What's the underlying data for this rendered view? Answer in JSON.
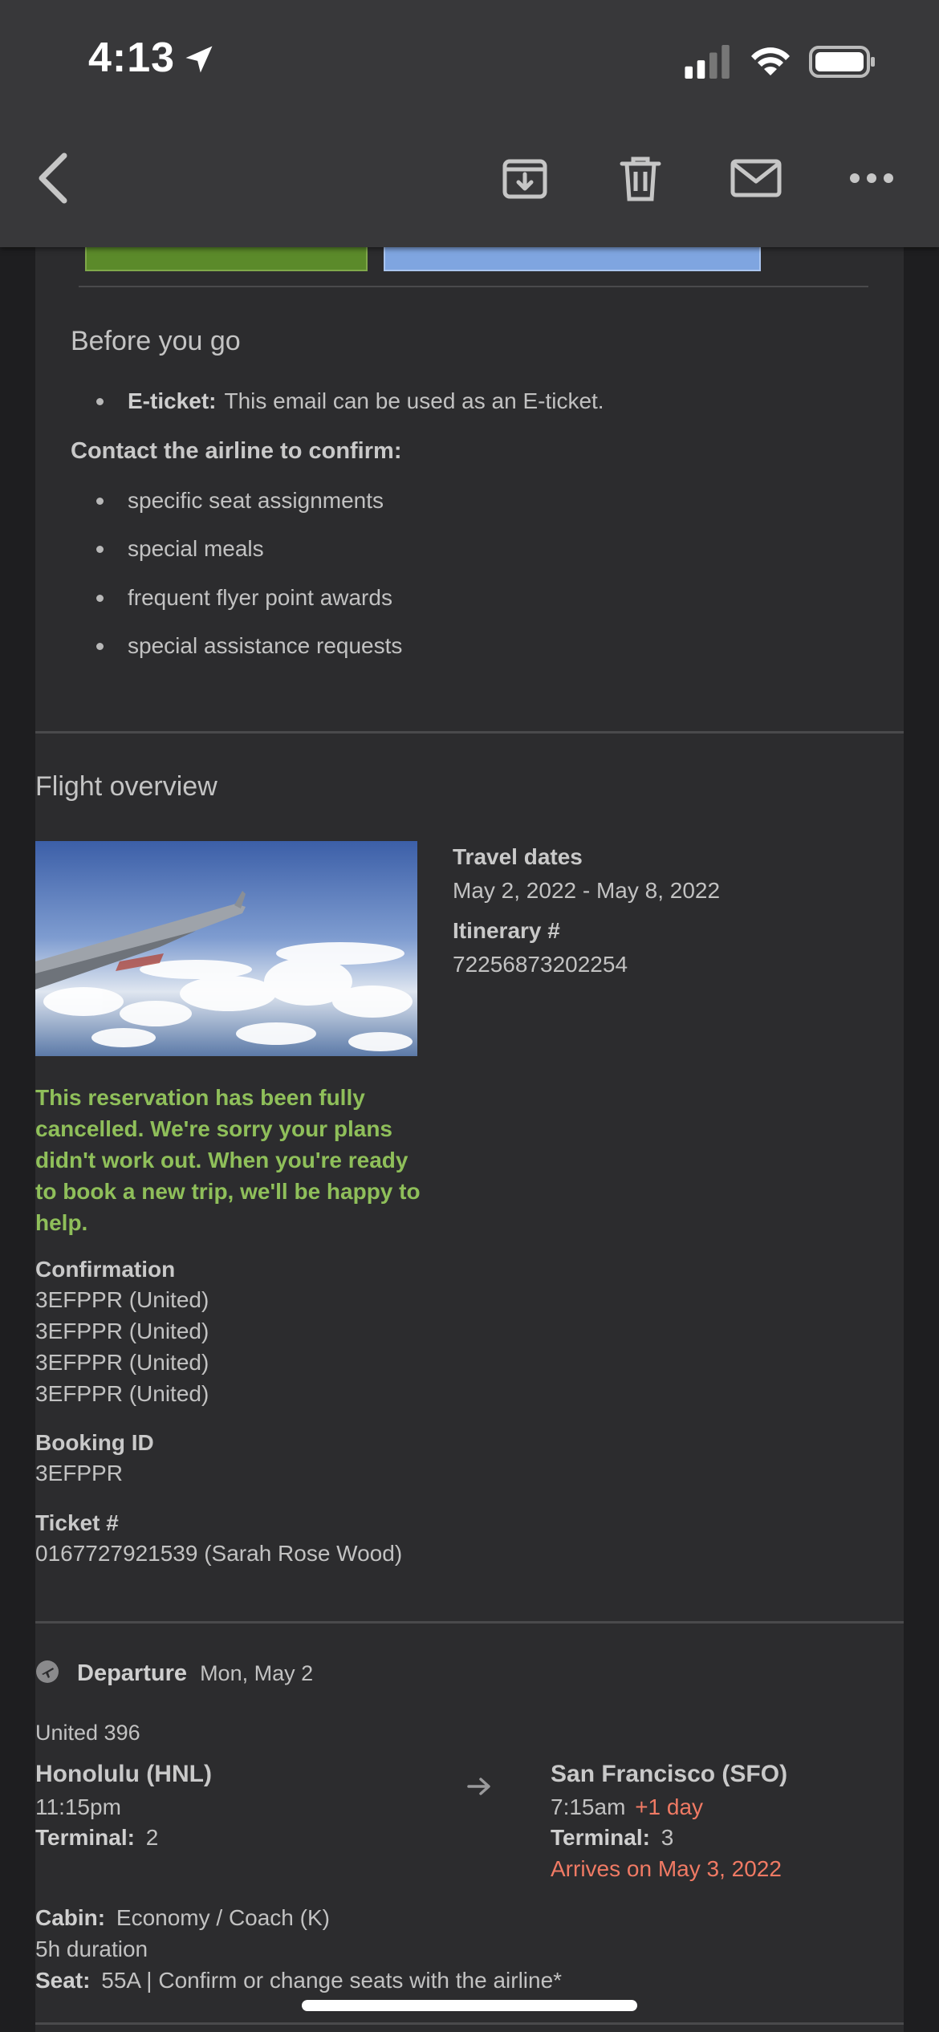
{
  "status_bar": {
    "time": "4:13"
  },
  "top_bar": {
    "back_icon": "chevron-left-icon",
    "archive_icon": "archive-icon",
    "delete_icon": "trash-icon",
    "mail_icon": "mail-icon",
    "more_icon": "more-icon"
  },
  "before_you_go": {
    "title": "Before you go",
    "eticket_label": "E-ticket:",
    "eticket_text": "This email can be used as an E-ticket.",
    "contact_title": "Contact the airline to confirm:",
    "items": [
      "specific seat assignments",
      "special meals",
      "frequent flyer point awards",
      "special assistance requests"
    ]
  },
  "overview": {
    "title": "Flight overview",
    "travel_dates_label": "Travel dates",
    "travel_dates": "May 2, 2022 - May 8, 2022",
    "itinerary_label": "Itinerary #",
    "itinerary": "72256873202254",
    "cancel_message": "This reservation has been fully cancelled. We're sorry your plans didn't work out. When you're ready to book a new trip, we'll be happy to help.",
    "confirmation_label": "Confirmation",
    "confirmations": [
      "3EFPPR (United)",
      "3EFPPR (United)",
      "3EFPPR (United)",
      "3EFPPR (United)"
    ],
    "booking_label": "Booking ID",
    "booking": "3EFPPR",
    "ticket_label": "Ticket #",
    "ticket": "0167727921539 (Sarah Rose Wood)"
  },
  "departure": {
    "label": "Departure",
    "date": "Mon, May 2",
    "flight": "United 396",
    "from_city": "Honolulu (HNL)",
    "from_time": "11:15pm",
    "terminal_label": "Terminal:",
    "from_terminal": "2",
    "to_city": "San Francisco (SFO)",
    "to_time": "7:15am",
    "plus_day": "+1 day",
    "to_terminal": "3",
    "arrives": "Arrives on May 3, 2022",
    "cabin_label": "Cabin:",
    "cabin": "Economy / Coach (K)",
    "duration": "5h duration",
    "seat_label": "Seat:",
    "seat": "55A | Confirm or change seats with the airline*"
  },
  "colors": {
    "background": "#2c2c2e",
    "green_button": "#5b8a2a",
    "blue_button": "#7fa5e0",
    "cancel_text": "#8fbf5a",
    "accent_salmon": "#f07a64"
  }
}
